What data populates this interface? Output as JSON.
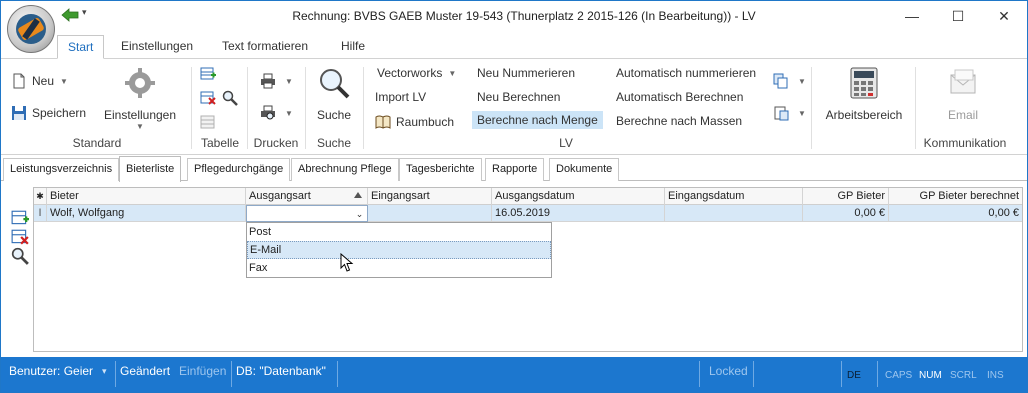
{
  "window": {
    "title": "Rechnung: BVBS GAEB Muster 19-543 (Thunerplatz 2 2015-126 (In Bearbeitung)) - LV",
    "minimize": "—",
    "maximize": "☐",
    "close": "✕",
    "qa_dropdown": "▾"
  },
  "ribbon_tabs": [
    {
      "label": "Start",
      "active": true
    },
    {
      "label": "Einstellungen"
    },
    {
      "label": "Text formatieren"
    },
    {
      "label": "Hilfe"
    }
  ],
  "ribbon": {
    "standard": {
      "neu": "Neu",
      "speichern": "Speichern",
      "einstellungen": "Einstellungen",
      "label": "Standard"
    },
    "tabelle": {
      "label": "Tabelle"
    },
    "drucken": {
      "label": "Drucken"
    },
    "suche": {
      "button": "Suche",
      "label": "Suche"
    },
    "lv": {
      "vectorworks": "Vectorworks",
      "import_lv": "Import LV",
      "raumbuch": "Raumbuch",
      "neu_nummerieren": "Neu Nummerieren",
      "neu_berechnen": "Neu Berechnen",
      "berechne_menge": "Berechne nach Menge",
      "auto_nummerieren": "Automatisch nummerieren",
      "auto_berechnen": "Automatisch Berechnen",
      "berechne_massen": "Berechne nach Massen",
      "label": "LV"
    },
    "arbeitsbereich": {
      "button": "Arbeitsbereich"
    },
    "kommunikation": {
      "email": "Email",
      "label": "Kommunikation"
    }
  },
  "doc_tabs": [
    {
      "label": "Leistungsverzeichnis"
    },
    {
      "label": "Bieterliste",
      "active": true
    },
    {
      "label": "Pflegedurchgänge"
    },
    {
      "label": "Abrechnung Pflege"
    },
    {
      "label": "Tagesberichte"
    },
    {
      "label": "Rapporte"
    },
    {
      "label": "Dokumente"
    }
  ],
  "grid": {
    "marker_header": "✱",
    "marker_row": "I",
    "columns": [
      "Bieter",
      "Ausgangsart",
      "Eingangsart",
      "Ausgangsdatum",
      "Eingangsdatum",
      "GP Bieter",
      "GP Bieter berechnet"
    ],
    "rows": [
      {
        "bieter": "Wolf, Wolfgang",
        "ausgangsart": "",
        "eingangsart": "",
        "ausgangsdatum": "16.05.2019",
        "eingangsdatum": "",
        "gp_bieter": "0,00 €",
        "gp_bieter_berechnet": "0,00 €"
      }
    ],
    "combo_arrow": "⌄"
  },
  "dropdown_options": [
    "Post",
    "E-Mail",
    "Fax"
  ],
  "dropdown_selected": "E-Mail",
  "statusbar": {
    "benutzer": "Benutzer: Geier",
    "benutzer_dd": "▾",
    "geaendert": "Geändert",
    "einfuegen": "Einfügen",
    "db": "DB: \"Datenbank\"",
    "locked": "Locked",
    "lang": "DE",
    "caps": "CAPS",
    "num": "NUM",
    "scrl": "SCRL",
    "ins": "INS"
  },
  "colors": {
    "accent": "#1f6fbf",
    "statusbar": "#1c77cf",
    "row_selected": "#d7e8f7",
    "highlight": "#cce4f7"
  }
}
